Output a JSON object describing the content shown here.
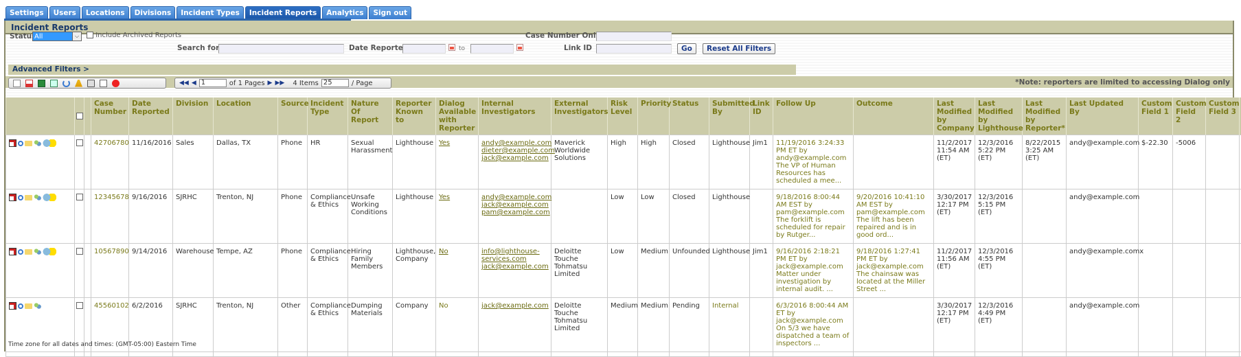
{
  "tabs": [
    {
      "label": "Settings",
      "active": false
    },
    {
      "label": "Users",
      "active": false
    },
    {
      "label": "Locations",
      "active": false
    },
    {
      "label": "Divisions",
      "active": false
    },
    {
      "label": "Incident Types",
      "active": false
    },
    {
      "label": "Incident Reports",
      "active": true
    },
    {
      "label": "Analytics",
      "active": false
    },
    {
      "label": "Sign out",
      "active": false
    }
  ],
  "panel": {
    "title": "Incident Reports"
  },
  "filters": {
    "status_label": "Status",
    "status_value": "All",
    "include_archived_label": "Include Archived Reports",
    "case_number_label": "Case Number Only",
    "case_number_value": "",
    "search_label": "Search for",
    "search_value": "",
    "date_reported_label": "Date Reported",
    "date_from": "",
    "date_to_label": "to",
    "date_to": "",
    "link_id_label": "Link ID",
    "link_id_value": "",
    "go_label": "Go",
    "reset_label": "Reset All Filters",
    "advanced_label": "Advanced Filters >"
  },
  "toolbar": {
    "icons": [
      "new-report-icon",
      "pdf-export-icon",
      "excel-export-icon",
      "export-icon",
      "refresh-icon",
      "clear-filters-icon",
      "print-icon",
      "email-icon",
      "search-stop-icon"
    ],
    "pager": {
      "page": "1",
      "of_pages": "of 1 Pages",
      "items": "4 Items",
      "per_page": "25",
      "per_page_label": "/ Page"
    },
    "note": "*Note: reporters are limited to accessing Dialog only"
  },
  "table": {
    "headers": [
      "Case Number",
      "Date Reported",
      "Division",
      "Location",
      "Source",
      "Incident Type",
      "Nature Of Report",
      "Reporter Known to",
      "Dialog Available with Reporter",
      "Internal Investigators",
      "External Investigators",
      "Risk Level",
      "Priority",
      "Status",
      "Submitted By",
      "Link ID",
      "Follow Up",
      "Outcome",
      "Last Modified by Company",
      "Last Modified by Lighthouse",
      "Last Modified by Reporter*",
      "Last Updated By",
      "Custom Field 1",
      "Custom Field 2",
      "Custom Field 3"
    ],
    "rows": [
      {
        "case_number": "42706780",
        "date_reported": "11/16/2016",
        "division": "Sales",
        "location": "Dallas, TX",
        "source": "Phone",
        "incident_type": "HR",
        "nature": "Sexual Harassment",
        "reporter_known": "Lighthouse",
        "dialog": "Yes",
        "internal": "andy@example.com\ndieter@example.com\njack@example.com",
        "external": "Maverick Worldwide Solutions",
        "risk": "High",
        "priority": "High",
        "status": "Closed",
        "submitted_by": "Lighthouse",
        "link_id": "Jim1",
        "follow_up": "11/19/2016 3:24:33 PM ET by andy@example.com The VP of Human Resources has scheduled a mee...",
        "outcome": "",
        "mod_company": "11/2/2017 11:54 AM (ET)",
        "mod_lighthouse": "12/3/2016 5:22 PM (ET)",
        "mod_reporter": "8/22/2015 3:25 AM (ET)",
        "updated_by": "andy@example.com",
        "custom1": "$-22.30",
        "custom2": "-5006",
        "custom3": "",
        "has_dialog_icon": true
      },
      {
        "case_number": "12345678",
        "date_reported": "9/16/2016",
        "division": "SJRHC",
        "location": "Trenton, NJ",
        "source": "Phone",
        "incident_type": "Compliance & Ethics",
        "nature": "Unsafe Working Conditions",
        "reporter_known": "Lighthouse",
        "dialog": "Yes",
        "internal": "andy@example.com\njack@example.com\npam@example.com",
        "external": "",
        "risk": "Low",
        "priority": "Low",
        "status": "Closed",
        "submitted_by": "Lighthouse",
        "link_id": "",
        "follow_up": "9/18/2016 8:00:44 AM EST by pam@example.com The forklift is scheduled for repair by Rutger...",
        "outcome": "9/20/2016 10:41:10 AM EST by pam@example.com The lift has been repaired and is in good ord...",
        "mod_company": "3/30/2017 12:17 PM (ET)",
        "mod_lighthouse": "12/3/2016 5:15 PM (ET)",
        "mod_reporter": "",
        "updated_by": "andy@example.com",
        "custom1": "",
        "custom2": "",
        "custom3": "",
        "has_dialog_icon": true
      },
      {
        "case_number": "10567890",
        "date_reported": "9/14/2016",
        "division": "Warehouse",
        "location": "Tempe, AZ",
        "source": "Phone",
        "incident_type": "Compliance & Ethics",
        "nature": "Hiring Family Members",
        "reporter_known": "Lighthouse, Company",
        "dialog": "No",
        "internal": "info@lighthouse-services.com\njack@example.com",
        "external": "Deloitte Touche Tohmatsu Limited",
        "risk": "Low",
        "priority": "Medium",
        "status": "Unfounded",
        "submitted_by": "Lighthouse",
        "link_id": "Jim1",
        "follow_up": "9/16/2016 2:18:21 PM ET by jack@example.com Matter under investigation by internal audit. ...",
        "outcome": "9/18/2016 1:27:41 PM ET by jack@example.com The chainsaw was located at the Miller Street ...",
        "mod_company": "11/2/2017 11:56 AM (ET)",
        "mod_lighthouse": "12/3/2016 4:55 PM (ET)",
        "mod_reporter": "",
        "updated_by": "andy@example.comx",
        "custom1": "",
        "custom2": "",
        "custom3": "",
        "has_dialog_icon": true
      },
      {
        "case_number": "45560102",
        "date_reported": "6/2/2016",
        "division": "SJRHC",
        "location": "Trenton, NJ",
        "source": "Other",
        "incident_type": "Compliance & Ethics",
        "nature": "Dumping Materials",
        "reporter_known": "Company",
        "dialog": "No",
        "internal": "jack@example.com",
        "external": "Deloitte Touche Tohmatsu Limited",
        "risk": "Medium",
        "priority": "Medium",
        "status": "Pending",
        "submitted_by": "Internal",
        "link_id": "",
        "follow_up": "6/3/2016 8:00:44 AM ET by jack@example.com On 5/3 we have dispatched a team of inspectors ...",
        "outcome": "",
        "mod_company": "3/30/2017 12:17 PM (ET)",
        "mod_lighthouse": "12/3/2016 4:49 PM (ET)",
        "mod_reporter": "",
        "updated_by": "andy@example.com",
        "custom1": "",
        "custom2": "",
        "custom3": "",
        "has_dialog_icon": false
      }
    ]
  },
  "footer": {
    "timezone": "Time zone for all dates and times: (GMT-05:00) Eastern Time"
  },
  "colors": {
    "tab_blue": "#3d7fd0",
    "panel_header": "#cccca9",
    "olive_text": "#7a7a1a",
    "title_blue": "#1a3a6a"
  }
}
